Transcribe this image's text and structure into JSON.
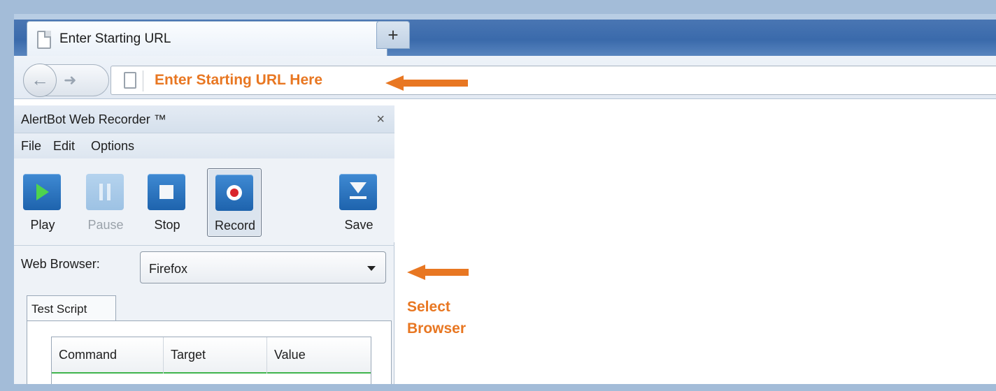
{
  "browser": {
    "tab_title": "Enter Starting URL",
    "new_tab_label": "+",
    "url_placeholder_annotation": "Enter Starting URL Here"
  },
  "recorder": {
    "title": "AlertBot Web Recorder ™",
    "close_label": "×",
    "menu": {
      "file": "File",
      "edit": "Edit",
      "options": "Options"
    },
    "toolbar": {
      "play": "Play",
      "pause": "Pause",
      "stop": "Stop",
      "record": "Record",
      "save": "Save"
    },
    "web_browser_label": "Web Browser:",
    "web_browser_value": "Firefox",
    "script_tab": "Test Script",
    "table_headers": [
      "Command",
      "Target",
      "Value"
    ]
  },
  "annotations": {
    "select_browser_line1": "Select",
    "select_browser_line2": "Browser"
  },
  "colors": {
    "annotation": "#e87722",
    "frame": "#a3bcd8",
    "button_blue": "#1e63ad"
  }
}
